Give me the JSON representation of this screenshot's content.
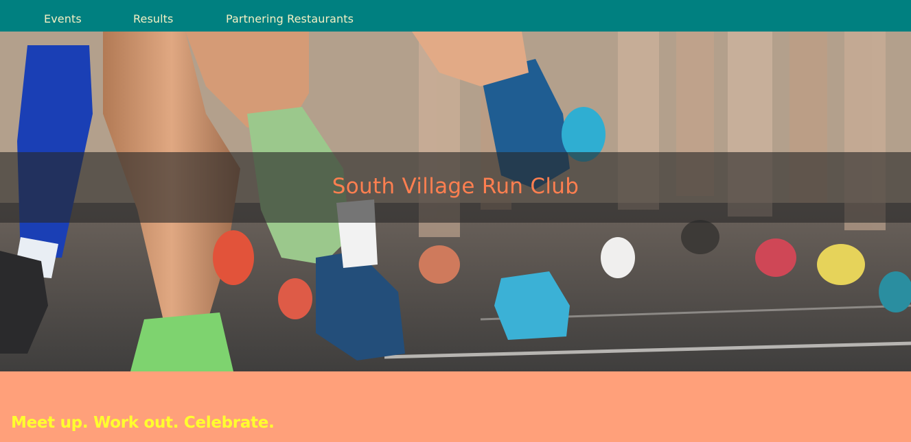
{
  "nav": {
    "links": [
      {
        "label": "Events"
      },
      {
        "label": "Results"
      },
      {
        "label": "Partnering Restaurants"
      }
    ]
  },
  "hero": {
    "title": "South Village Run Club",
    "image": "runners-legs-photo"
  },
  "intro": {
    "tagline": "Meet up. Work out. Celebrate."
  },
  "colors": {
    "nav_bg": "#008080",
    "nav_text": "#f4f0c4",
    "title": "#ff7f50",
    "intro_bg": "#ffa07a",
    "tagline": "#ffff2e"
  }
}
